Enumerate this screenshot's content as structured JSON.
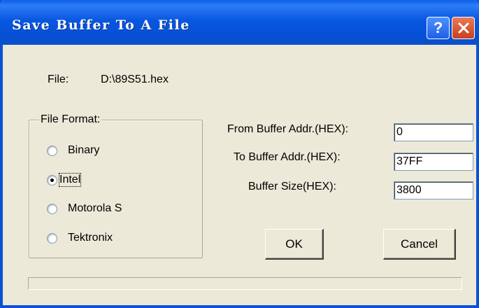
{
  "window": {
    "title": "Save Buffer To A File",
    "help_label": "?"
  },
  "file": {
    "label": "File:",
    "path": "D:\\89S51.hex"
  },
  "file_format": {
    "legend": "File Format:",
    "options": [
      {
        "label": "Binary",
        "checked": false
      },
      {
        "label": "Intel",
        "checked": true
      },
      {
        "label": "Motorola S",
        "checked": false
      },
      {
        "label": "Tektronix",
        "checked": false
      }
    ]
  },
  "fields": {
    "from_label": "From Buffer Addr.(HEX):",
    "from_value": "0",
    "to_label": "To Buffer Addr.(HEX):",
    "to_value": "37FF",
    "size_label": "Buffer Size(HEX):",
    "size_value": "3800"
  },
  "buttons": {
    "ok": "OK",
    "cancel": "Cancel"
  },
  "progress": {
    "value": 0
  }
}
